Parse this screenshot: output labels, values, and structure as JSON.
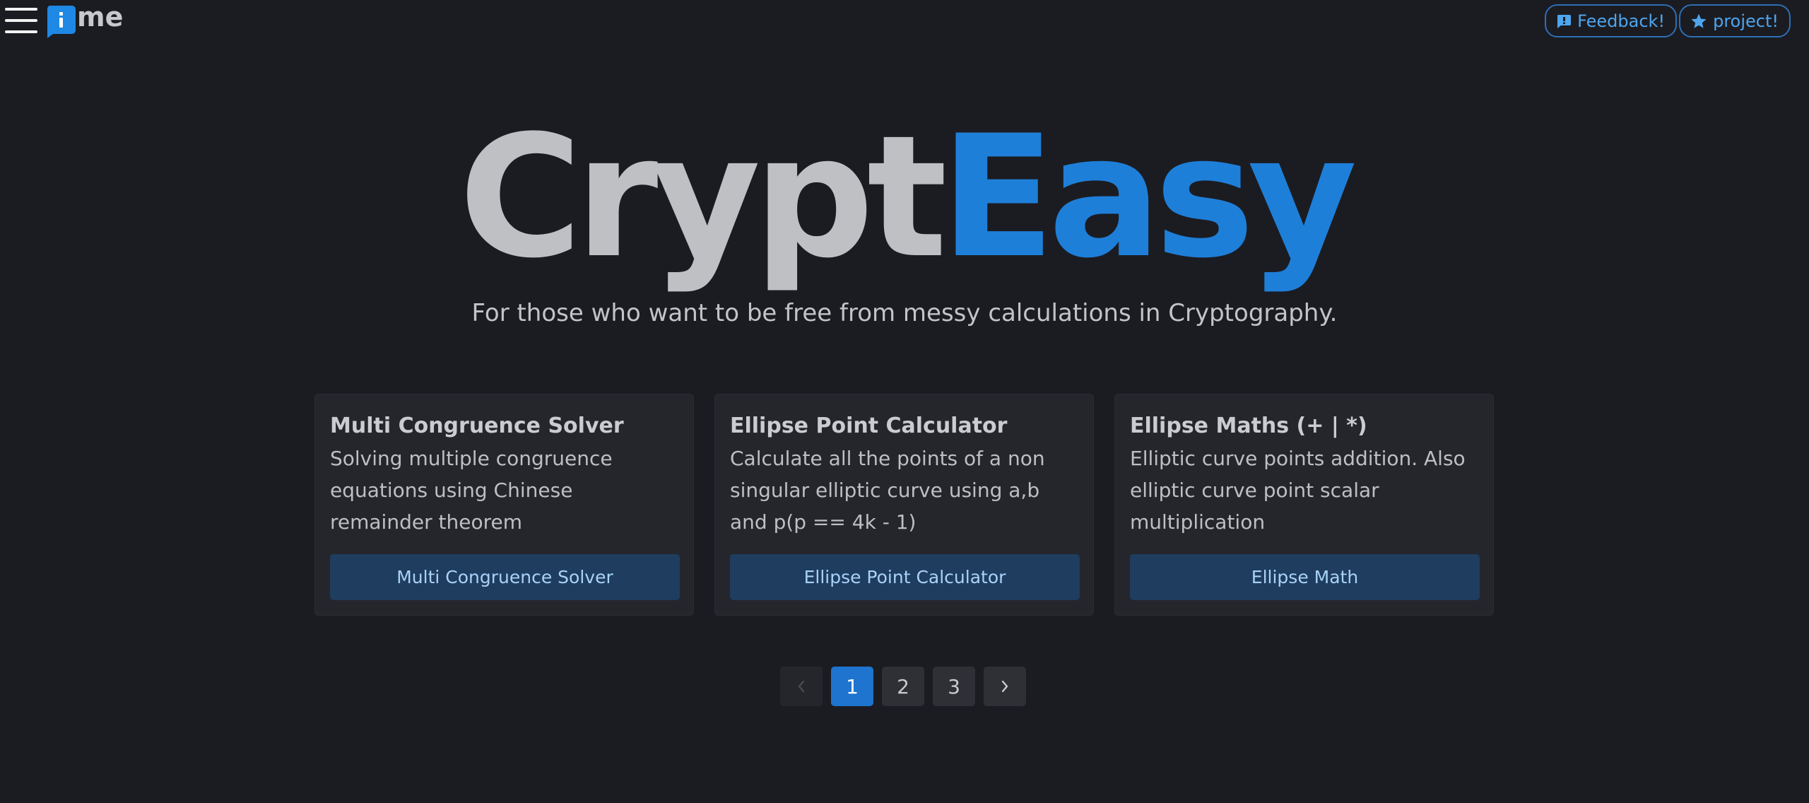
{
  "header": {
    "logo_text": "me",
    "feedback_label": "Feedback!",
    "project_label": "project!"
  },
  "hero": {
    "title_part1": "Crypt",
    "title_part2": "Easy",
    "tagline": "For those who want to be free from messy calculations in Cryptography."
  },
  "cards": [
    {
      "title": "Multi Congruence Solver",
      "description": "Solving multiple congruence equations using Chinese remainder theorem",
      "button_label": "Multi Congruence Solver"
    },
    {
      "title": "Ellipse Point Calculator",
      "description": "Calculate all the points of a non singular elliptic curve using a,b and p(p == 4k - 1)",
      "button_label": "Ellipse Point Calculator"
    },
    {
      "title": "Ellipse Maths (+ | *)",
      "description": "Elliptic curve points addition. Also elliptic curve point scalar multiplication",
      "button_label": "Ellipse Math"
    }
  ],
  "pagination": {
    "prev_icon": "chevron-left-icon",
    "next_icon": "chevron-right-icon",
    "pages": [
      "1",
      "2",
      "3"
    ],
    "active_page": "1"
  },
  "colors": {
    "background": "#1b1c21",
    "accent": "#1e7fd9",
    "card_background": "#25262c",
    "card_button": "#1f3d5f"
  }
}
